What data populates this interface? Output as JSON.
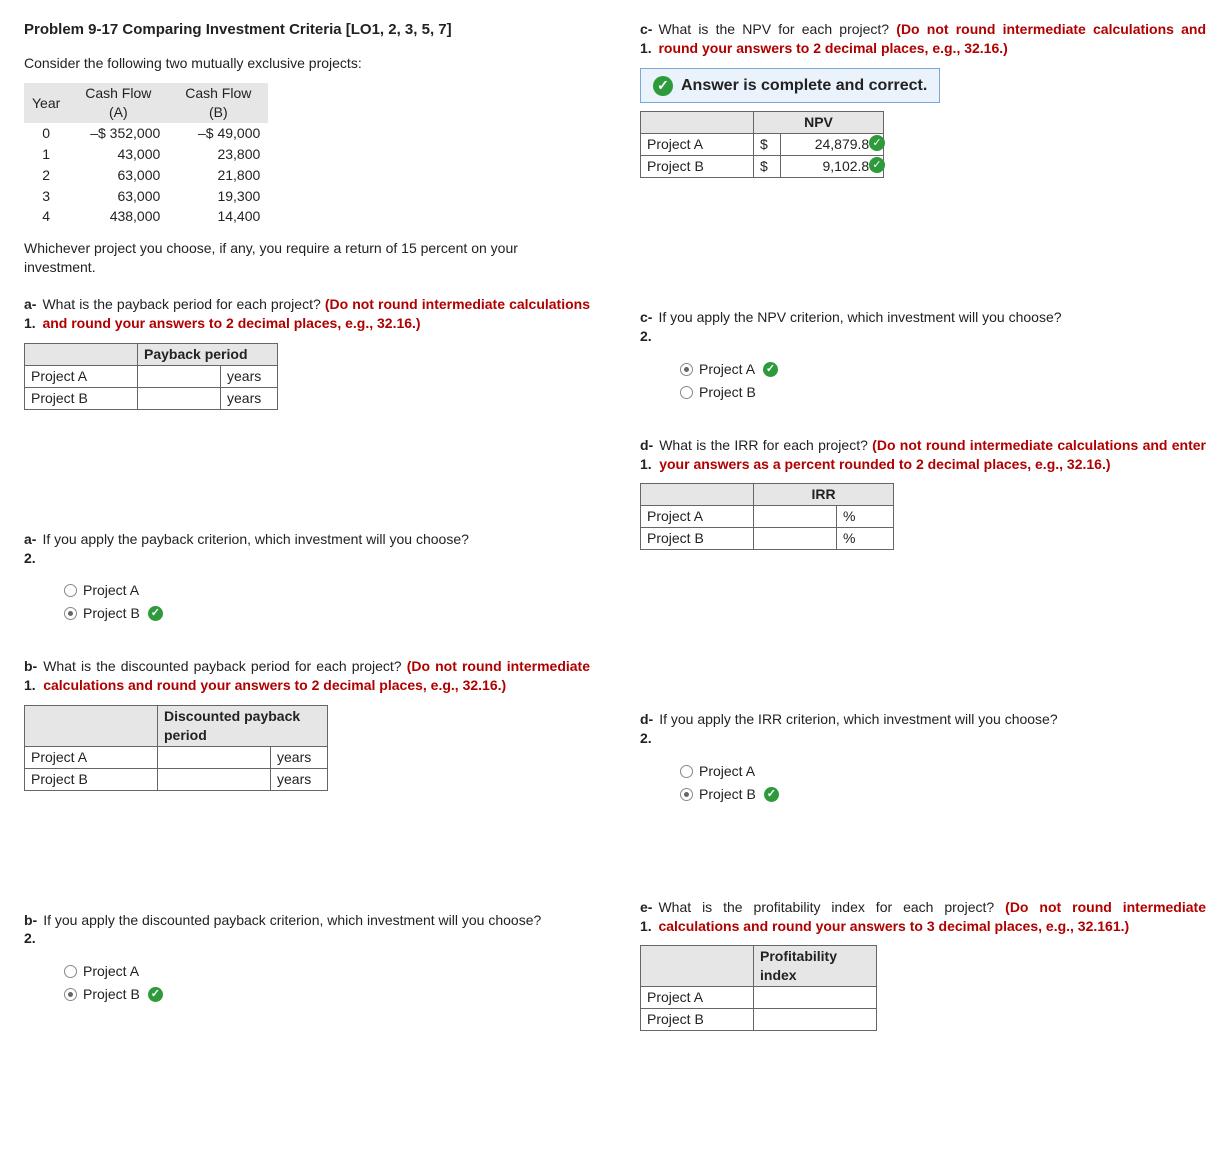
{
  "title": "Problem 9-17 Comparing Investment Criteria [LO1, 2, 3, 5, 7]",
  "intro": "Consider the following two mutually exclusive projects:",
  "cf": {
    "h_year": "Year",
    "h_a": "Cash Flow (A)",
    "h_b": "Cash Flow (B)",
    "rows": [
      {
        "y": "0",
        "a": "–$ 352,000",
        "b": "–$ 49,000"
      },
      {
        "y": "1",
        "a": "43,000",
        "b": "23,800"
      },
      {
        "y": "2",
        "a": "63,000",
        "b": "21,800"
      },
      {
        "y": "3",
        "a": "63,000",
        "b": "19,300"
      },
      {
        "y": "4",
        "a": "438,000",
        "b": "14,400"
      }
    ]
  },
  "req": "Whichever project you choose, if any, you require a return of 15 percent on your investment.",
  "a1": {
    "num1": "a-",
    "num2": "1.",
    "text": "What is the payback period for each project? ",
    "red": "(Do not round intermediate calculations and round your answers to 2 decimal places, e.g., 32.16.)",
    "header": "Payback period",
    "rowA": "Project A",
    "rowB": "Project B",
    "unit": "years"
  },
  "a2": {
    "num1": "a-",
    "num2": "2.",
    "text": "If you apply the payback criterion, which investment will you choose?",
    "optA": "Project A",
    "optB": "Project B",
    "selected": "B"
  },
  "b1": {
    "num1": "b-",
    "num2": "1.",
    "text": "What is the discounted payback period for each project? ",
    "red": "(Do not round intermediate calculations and round your answers to 2 decimal places, e.g., 32.16.)",
    "header": "Discounted payback period",
    "rowA": "Project A",
    "rowB": "Project B",
    "unit": "years"
  },
  "b2": {
    "num1": "b-",
    "num2": "2.",
    "text": "If you apply the discounted payback criterion, which investment will you choose?",
    "optA": "Project A",
    "optB": "Project B",
    "selected": "B"
  },
  "c1": {
    "num1": "c-",
    "num2": "1.",
    "text": "What is the NPV for each project? ",
    "red": "(Do not round intermediate calculations and round your answers to 2 decimal places, e.g., 32.16.)",
    "banner": "Answer is complete and correct.",
    "header": "NPV",
    "rowA": "Project A",
    "rowB": "Project B",
    "cur": "$",
    "valA": "24,879.80",
    "valB": "9,102.89"
  },
  "c2": {
    "num1": "c-",
    "num2": "2.",
    "text": "If you apply the NPV criterion, which investment will you choose?",
    "optA": "Project A",
    "optB": "Project B",
    "selected": "A"
  },
  "d1": {
    "num1": "d-",
    "num2": "1.",
    "text": "What is the IRR for each project? ",
    "red": "(Do not round intermediate calculations and enter your answers as a percent rounded to 2 decimal places, e.g., 32.16.)",
    "header": "IRR",
    "rowA": "Project A",
    "rowB": "Project B",
    "unit": "%"
  },
  "d2": {
    "num1": "d-",
    "num2": "2.",
    "text": "If you apply the IRR criterion, which investment will you choose?",
    "optA": "Project A",
    "optB": "Project B",
    "selected": "B"
  },
  "e1": {
    "num1": "e-",
    "num2": "1.",
    "text": "What is the profitability index for each project? ",
    "red": "(Do not round intermediate calculations and round your answers to 3 decimal places, e.g., 32.161.)",
    "header": "Profitability index",
    "rowA": "Project A",
    "rowB": "Project B"
  }
}
